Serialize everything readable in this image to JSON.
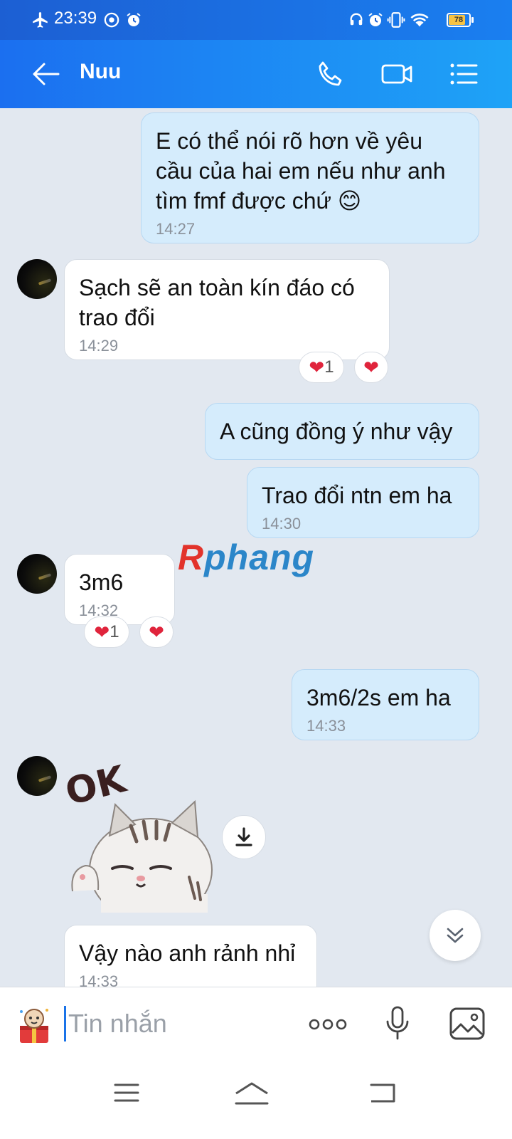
{
  "status_bar": {
    "time": "23:39",
    "battery": "78",
    "battery_fraction": 0.78,
    "icons": [
      "airplane-icon",
      "chrome-icon",
      "alarm-icon",
      "headphones-icon",
      "alarm-icon",
      "vibrate-icon",
      "wifi-icon",
      "battery-icon"
    ]
  },
  "header": {
    "title": "Nuu",
    "icons": [
      "back-arrow-icon",
      "phone-icon",
      "video-call-icon",
      "menu-list-icon"
    ]
  },
  "messages": [
    {
      "direction": "out",
      "text": "E có thể nói rõ hơn về yêu cầu của hai em nếu như anh tìm fmf được chứ 😊",
      "time": "14:27"
    },
    {
      "direction": "in",
      "text": "Sạch sẽ an toàn kín đáo có trao đổi",
      "time": "14:29",
      "reactions": [
        "❤️1",
        "❤️"
      ]
    },
    {
      "direction": "out",
      "text": "A cũng đồng ý như vậy",
      "time": ""
    },
    {
      "direction": "out",
      "text": "Trao đổi ntn em ha",
      "time": "14:30"
    },
    {
      "direction": "in",
      "text": "3m6",
      "time": "14:32",
      "reactions": [
        "❤️1",
        "❤️"
      ]
    },
    {
      "direction": "out",
      "text": "3m6/2s em ha",
      "time": "14:33"
    },
    {
      "direction": "in",
      "type": "sticker",
      "sticker_text": "OK"
    },
    {
      "direction": "in",
      "text": "Vậy nào anh rảnh nhỉ",
      "time": "14:33"
    }
  ],
  "reactions": {
    "heart": "❤",
    "count": "1"
  },
  "watermark": {
    "part1": "R",
    "part2": "phang"
  },
  "input": {
    "placeholder": "Tin nhắn",
    "icons": [
      "sticker-icon",
      "more-options-icon",
      "microphone-icon",
      "image-icon"
    ]
  },
  "nav_bar": {
    "icons": [
      "recent-apps-icon",
      "home-icon",
      "back-icon"
    ]
  },
  "colors": {
    "header": "#1b6ff0",
    "outgoing_bubble": "#d5ecfc",
    "incoming_bubble": "#ffffff",
    "background": "#e2e8f0",
    "heart": "#e0243c"
  }
}
